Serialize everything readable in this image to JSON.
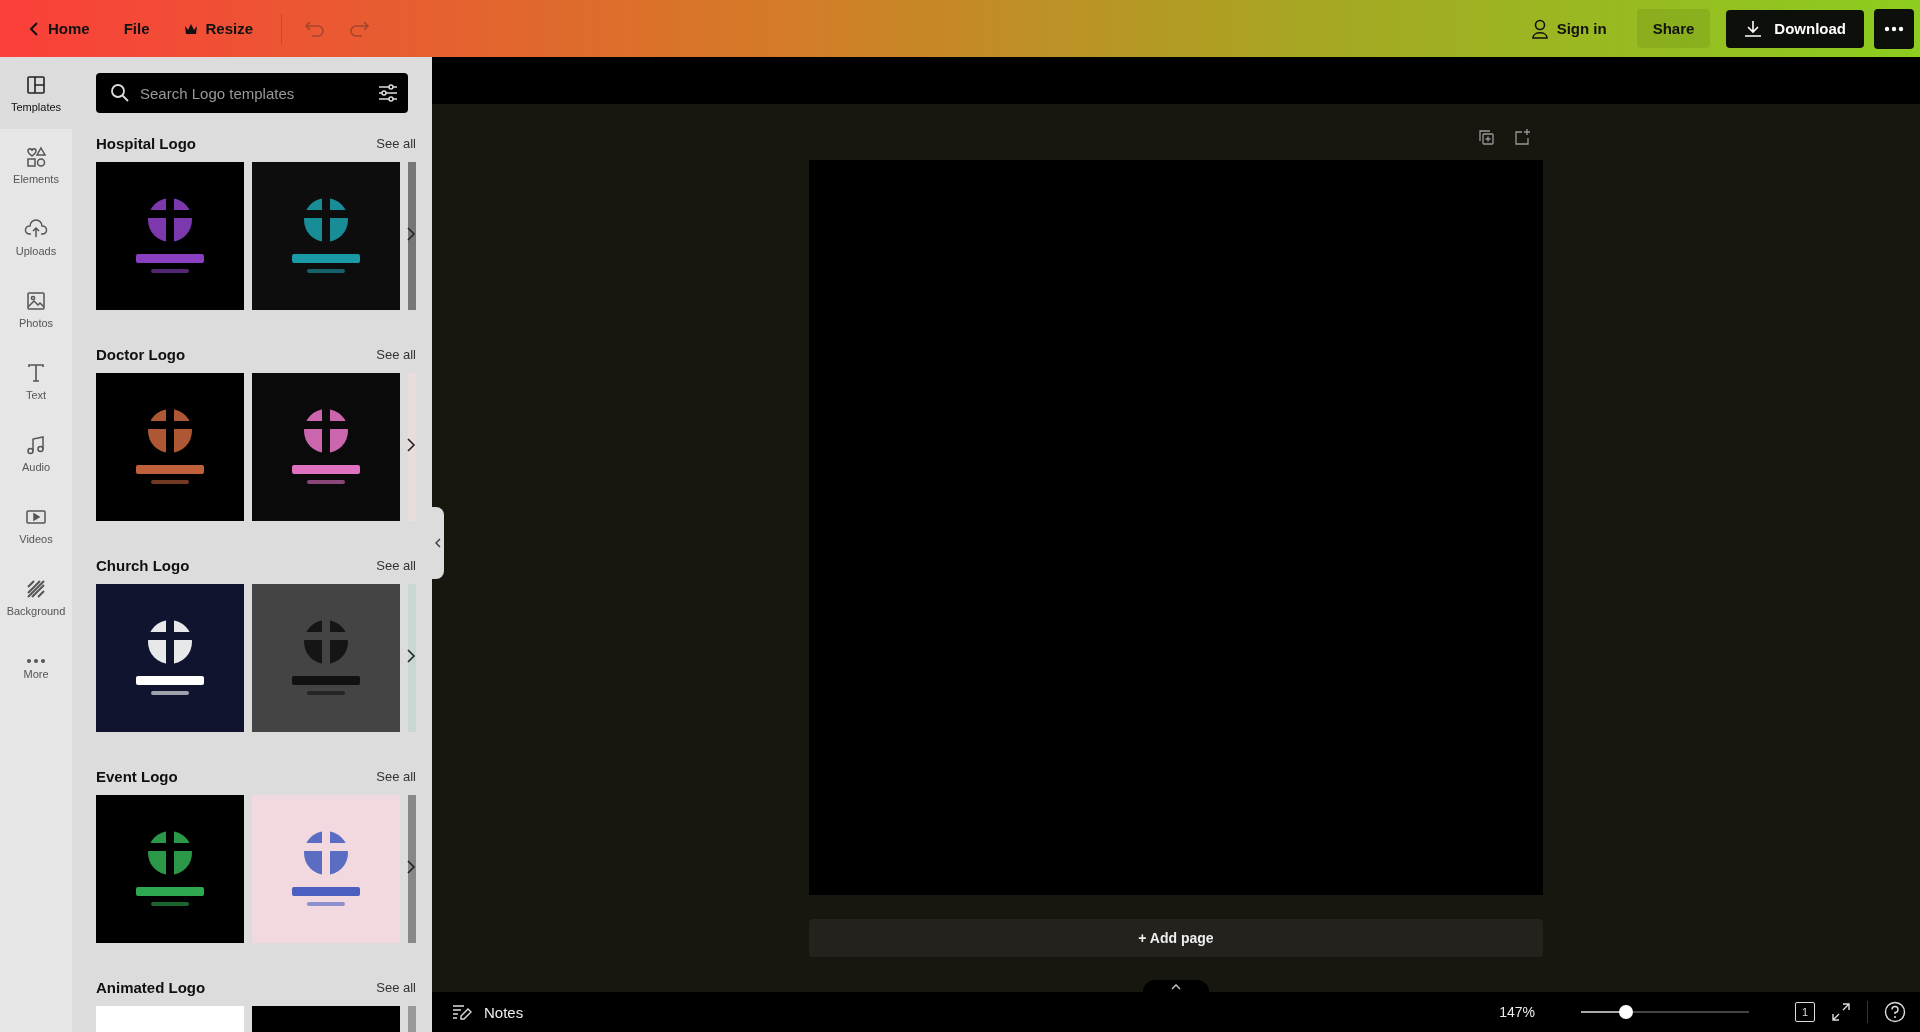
{
  "topbar": {
    "home": "Home",
    "file": "File",
    "resize": "Resize",
    "undo": {
      "disabled": true
    },
    "redo": {
      "disabled": true
    },
    "sign_in": "Sign in",
    "share": "Share",
    "download": "Download"
  },
  "rail": [
    {
      "kind": "templates",
      "label": "Templates",
      "selected": true
    },
    {
      "kind": "elements",
      "label": "Elements",
      "selected": false
    },
    {
      "kind": "uploads",
      "label": "Uploads",
      "selected": false
    },
    {
      "kind": "photos",
      "label": "Photos",
      "selected": false
    },
    {
      "kind": "text",
      "label": "Text",
      "selected": false
    },
    {
      "kind": "audio",
      "label": "Audio",
      "selected": false
    },
    {
      "kind": "videos",
      "label": "Videos",
      "selected": false
    },
    {
      "kind": "background",
      "label": "Background",
      "selected": false
    },
    {
      "kind": "more",
      "label": "More",
      "selected": false
    }
  ],
  "search": {
    "placeholder": "Search Logo templates"
  },
  "sections": [
    {
      "title": "Hospital Logo",
      "see_all": "See all"
    },
    {
      "title": "Doctor Logo",
      "see_all": "See all"
    },
    {
      "title": "Church Logo",
      "see_all": "See all"
    },
    {
      "title": "Event Logo",
      "see_all": "See all"
    },
    {
      "title": "Animated Logo",
      "see_all": "See all"
    }
  ],
  "canvas": {
    "add_page": "+ Add page"
  },
  "footer": {
    "notes": "Notes",
    "zoom": "147%",
    "level": 0.27,
    "page_count": "1"
  }
}
